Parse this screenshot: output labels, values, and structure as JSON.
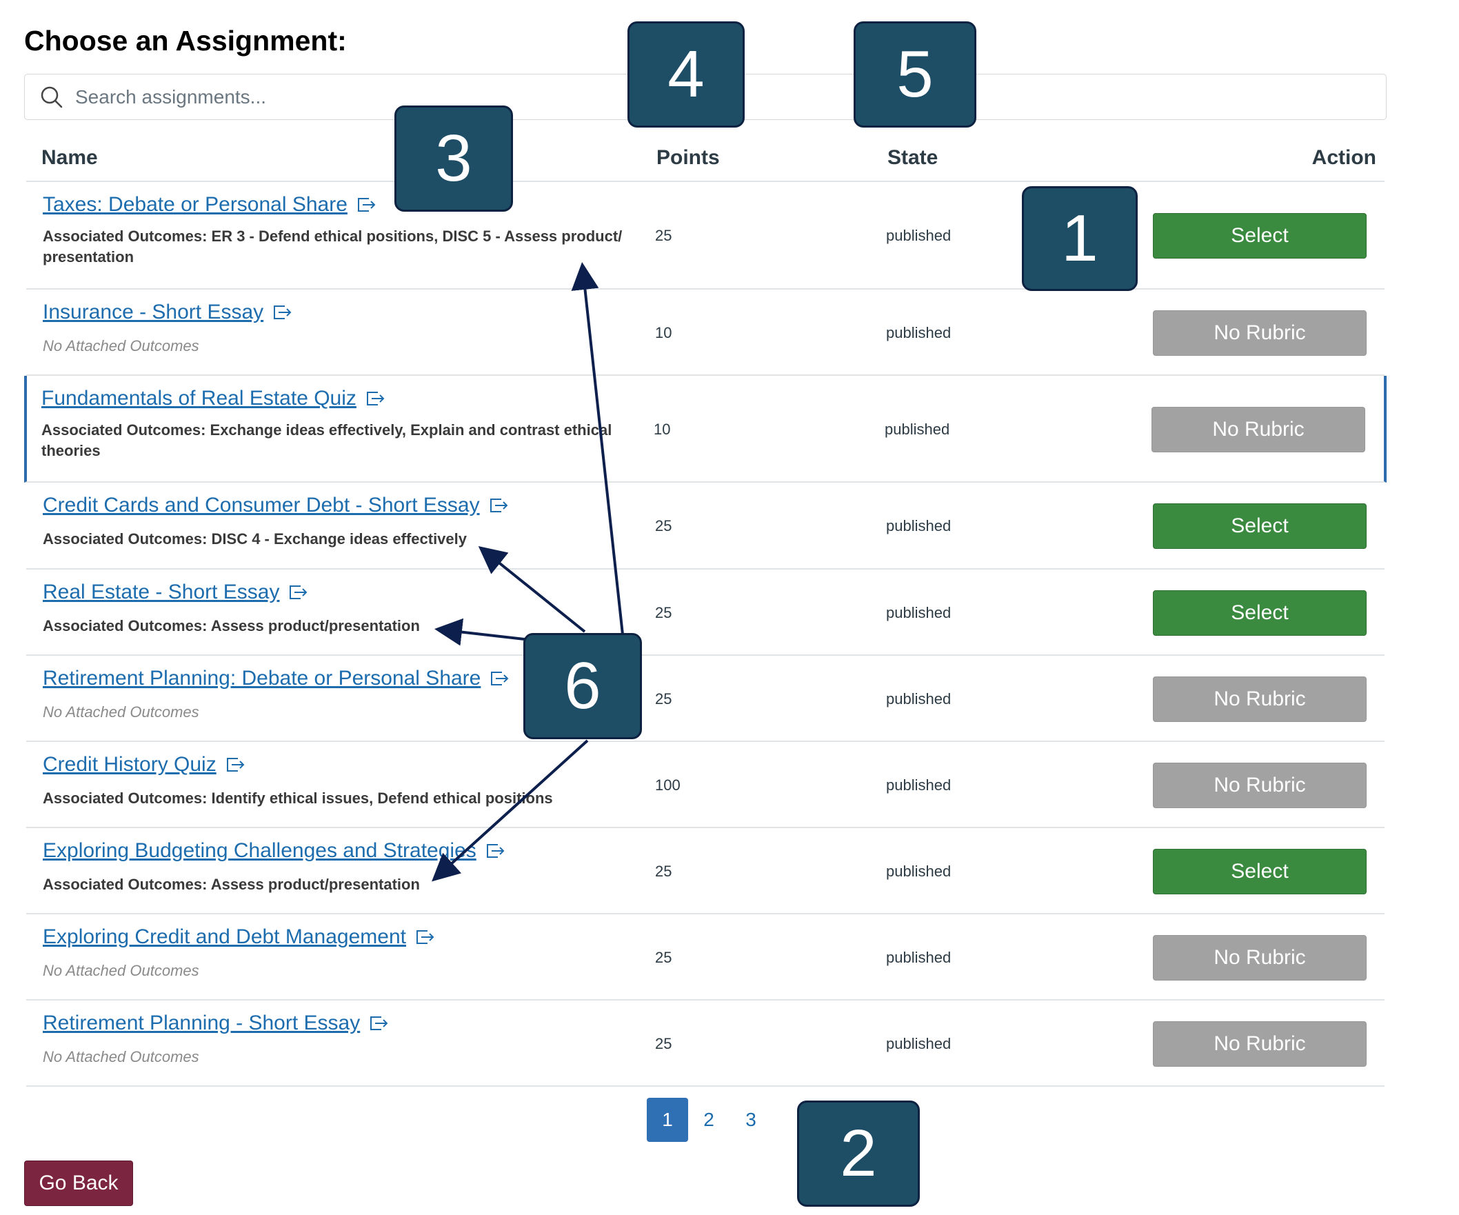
{
  "title": "Choose an Assignment:",
  "search": {
    "placeholder": "Search assignments..."
  },
  "columns": {
    "name": "Name",
    "points": "Points",
    "state": "State",
    "action": "Action"
  },
  "rows": [
    {
      "name": "Taxes: Debate or Personal Share",
      "outcomes": "Associated Outcomes: ER 3 - Defend ethical positions, DISC 5 - Assess product/ presentation",
      "points": "25",
      "state": "published",
      "action": "Select"
    },
    {
      "name": "Insurance - Short Essay",
      "outcomes": "No Attached Outcomes",
      "points": "10",
      "state": "published",
      "action": "No Rubric"
    },
    {
      "name": "Fundamentals of Real Estate Quiz",
      "outcomes": "Associated Outcomes: Exchange ideas effectively, Explain and contrast ethical theories",
      "points": "10",
      "state": "published",
      "action": "No Rubric"
    },
    {
      "name": "Credit Cards and Consumer Debt - Short Essay",
      "outcomes": "Associated Outcomes: DISC 4 - Exchange ideas effectively",
      "points": "25",
      "state": "published",
      "action": "Select"
    },
    {
      "name": "Real Estate - Short Essay",
      "outcomes": "Associated Outcomes: Assess product/presentation",
      "points": "25",
      "state": "published",
      "action": "Select"
    },
    {
      "name": "Retirement Planning: Debate or Personal Share",
      "outcomes": "No Attached Outcomes",
      "points": "25",
      "state": "published",
      "action": "No Rubric"
    },
    {
      "name": "Credit History Quiz",
      "outcomes": "Associated Outcomes: Identify ethical issues, Defend ethical positions",
      "points": "100",
      "state": "published",
      "action": "No Rubric"
    },
    {
      "name": "Exploring Budgeting Challenges and Strategies",
      "outcomes": "Associated Outcomes: Assess product/presentation",
      "points": "25",
      "state": "published",
      "action": "Select"
    },
    {
      "name": "Exploring Credit and Debt Management",
      "outcomes": "No Attached Outcomes",
      "points": "25",
      "state": "published",
      "action": "No Rubric"
    },
    {
      "name": "Retirement Planning - Short Essay",
      "outcomes": "No Attached Outcomes",
      "points": "25",
      "state": "published",
      "action": "No Rubric"
    }
  ],
  "pagination": [
    "1",
    "2",
    "3"
  ],
  "go_back": "Go Back",
  "badges": [
    "1",
    "2",
    "3",
    "4",
    "5",
    "6"
  ],
  "colors": {
    "select": "#3a8a3f",
    "no_rubric": "#a2a2a2",
    "link": "#1c6cae",
    "badge": "#1e4d66",
    "go_back": "#7b2540",
    "pager_active": "#2f6fb3"
  }
}
